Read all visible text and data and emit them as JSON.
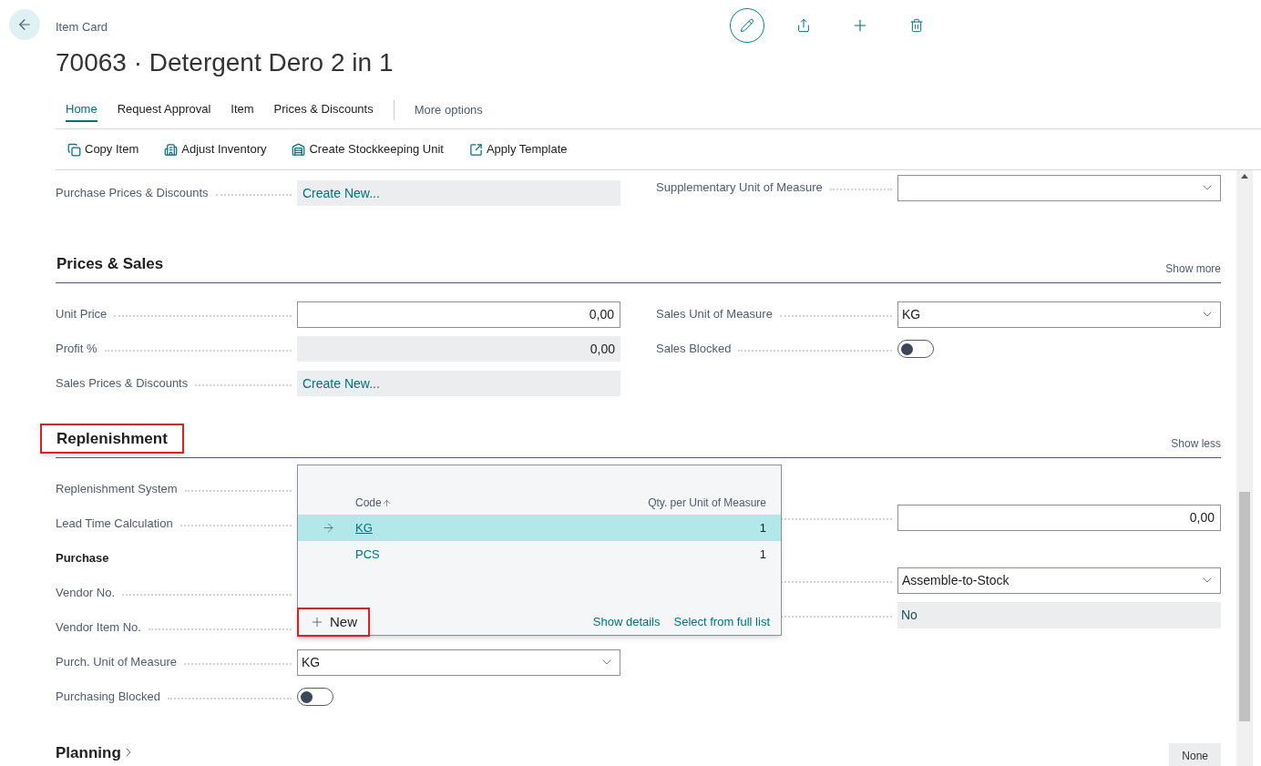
{
  "header": {
    "breadcrumb": "Item Card",
    "title": "70063 · Detergent Dero 2 in 1"
  },
  "tabs": [
    {
      "label": "Home",
      "selected": true
    },
    {
      "label": "Request Approval",
      "selected": false
    },
    {
      "label": "Item",
      "selected": false
    },
    {
      "label": "Prices & Discounts",
      "selected": false
    }
  ],
  "more_options": "More options",
  "actions": [
    {
      "kind": "copy",
      "label": "Copy Item"
    },
    {
      "kind": "adjust",
      "label": "Adjust Inventory"
    },
    {
      "kind": "stockkeeping",
      "label": "Create Stockkeeping Unit"
    },
    {
      "kind": "template",
      "label": "Apply Template"
    }
  ],
  "top_rows": {
    "left": [
      {
        "kind": "link",
        "label": "Purchase Prices & Discounts",
        "value": "Create New..."
      }
    ],
    "right": [
      {
        "kind": "dropdown",
        "label": "Supplementary Unit of Measure"
      }
    ]
  },
  "sections": [
    {
      "title": "Prices & Sales",
      "highlighted": false,
      "link": "Show more",
      "left": [
        {
          "kind": "number",
          "label": "Unit Price",
          "value": "0,00"
        },
        {
          "kind": "readonly_number",
          "label": "Profit %",
          "value": "0,00"
        },
        {
          "kind": "link",
          "label": "Sales Prices & Discounts",
          "value": "Create New..."
        }
      ],
      "right": [
        {
          "kind": "dropdown",
          "label": "Sales Unit of Measure",
          "value": "KG"
        },
        {
          "kind": "toggle",
          "label": "Sales Blocked",
          "on": false
        }
      ]
    },
    {
      "title": "Replenishment",
      "highlighted": true,
      "link": "Show less",
      "left": [
        {
          "kind": "covered",
          "label": "Replenishment System"
        },
        {
          "kind": "covered",
          "label": "Lead Time Calculation"
        },
        {
          "kind": "group",
          "label": "Purchase"
        },
        {
          "kind": "covered",
          "label": "Vendor No."
        },
        {
          "kind": "covered",
          "label": "Vendor Item No."
        },
        {
          "kind": "dropdown",
          "label": "Purch. Unit of Measure",
          "value": "KG"
        },
        {
          "kind": "toggle",
          "label": "Purchasing Blocked",
          "on": false
        }
      ],
      "right": [
        {
          "kind": "number",
          "value": "0,00"
        },
        {
          "kind": "dropdown",
          "value": "Assemble-to-Stock"
        },
        {
          "kind": "readonly",
          "value": "No"
        }
      ]
    }
  ],
  "lookup": {
    "columns": [
      "Code",
      "Qty. per Unit of Measure"
    ],
    "rows": [
      {
        "code": "KG",
        "qty": "1",
        "selected": true
      },
      {
        "code": "PCS",
        "qty": "1",
        "selected": false
      }
    ],
    "new_button": {
      "label": "New",
      "highlighted": true
    },
    "links": [
      "Show details",
      "Select from full list"
    ]
  },
  "planning": {
    "title": "Planning",
    "badge": "None"
  }
}
